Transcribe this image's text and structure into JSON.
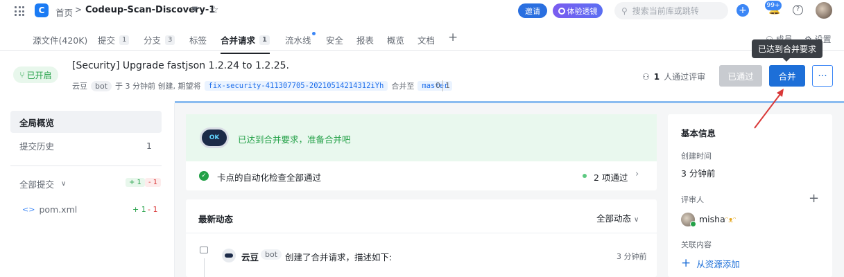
{
  "topbar": {
    "home": "首页",
    "repo_name": "Codeup-Scan-Discovery-1",
    "invite": "邀请",
    "experience": "体验透镜",
    "search_placeholder": "搜索当前库或跳转",
    "notification_badge": "99+",
    "help": "?"
  },
  "tabs": [
    {
      "label": "源文件(420K)"
    },
    {
      "label": "提交",
      "count": "1"
    },
    {
      "label": "分支",
      "count": "3"
    },
    {
      "label": "标签"
    },
    {
      "label": "合并请求",
      "count": "1"
    },
    {
      "label": "流水线"
    },
    {
      "label": "安全"
    },
    {
      "label": "报表"
    },
    {
      "label": "概览"
    },
    {
      "label": "文档"
    }
  ],
  "right_tabs": {
    "members": "成员",
    "settings": "设置"
  },
  "tooltip": "已达到合并要求",
  "mr": {
    "status": "已开启",
    "title": "[Security] Upgrade fastjson 1.2.24 to 1.2.25.",
    "author": "云豆",
    "author_tag": "bot",
    "meta_mid": "于 3 分钟前 创建, 期望将",
    "source_branch": "fix-security-411307705-20210514214312iYh",
    "meta_into": "合并至",
    "target_branch": "master",
    "diff_left": "0",
    "diff_right": "1",
    "reviewer_count": "1",
    "reviewer_text": "人通过评审",
    "btn_passed": "已通过",
    "btn_merge": "合并",
    "btn_more": "···"
  },
  "sidebar": {
    "overview": "全局概览",
    "history": "提交历史",
    "history_count": "1",
    "all_commits": "全部提交",
    "all_add": "+ 1",
    "all_del": "- 1",
    "file": "pom.xml",
    "file_add": "+ 1",
    "file_del": "- 1"
  },
  "ok_card": {
    "logo": "OK",
    "message": "已达到合并要求，准备合并吧",
    "checks": "卡点的自动化检查全部通过",
    "passed": "2 项通过"
  },
  "activity": {
    "title": "最新动态",
    "filter": "全部动态",
    "actor": "云豆",
    "actor_tag": "bot",
    "desc": "创建了合并请求，描述如下:",
    "time": "3 分钟前"
  },
  "info": {
    "title": "基本信息",
    "created_label": "创建时间",
    "created_value": "3 分钟前",
    "reviewers_label": "评审人",
    "reviewer_name": "misha",
    "related_label": "关联内容",
    "add_resource": "从资源添加"
  },
  "colors": {
    "primary": "#1d6fd8",
    "success": "#24a148",
    "tooltip_bg": "#3b3f45"
  }
}
